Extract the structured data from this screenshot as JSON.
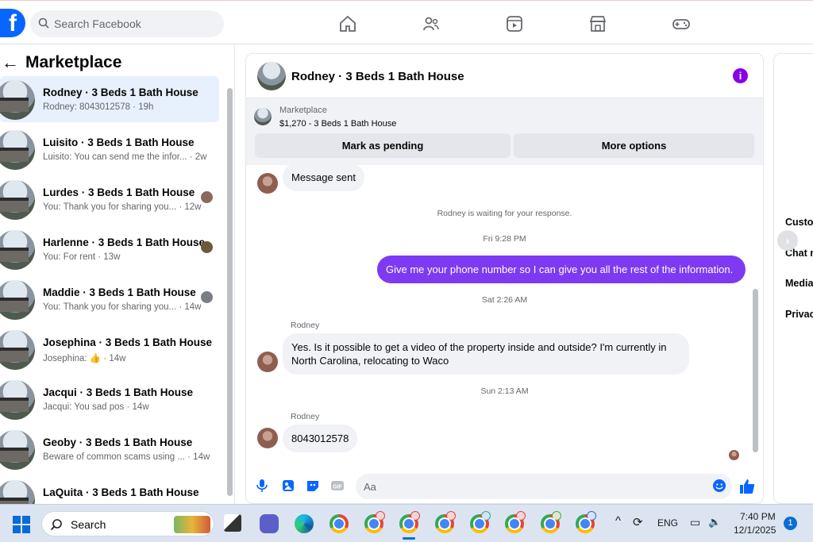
{
  "topbar": {
    "logo": "f",
    "search_placeholder": "Search Facebook",
    "nav_icons": [
      "home-icon",
      "friends-icon",
      "watch-icon",
      "marketplace-icon",
      "gaming-icon"
    ]
  },
  "sidebar": {
    "title": "Marketplace",
    "conversations": [
      {
        "name": "Rodney · 3 Beds 1 Bath House",
        "preview": "Rodney: 8043012578 · 19h",
        "selected": true
      },
      {
        "name": "Luisito · 3 Beds 1 Bath House",
        "preview": "Luisito: You can send me the infor... · 2w"
      },
      {
        "name": "Lurdes · 3 Beds 1 Bath House",
        "preview": "You: Thank you for sharing you... · 12w"
      },
      {
        "name": "Harlenne · 3 Beds 1 Bath House",
        "preview": "You: For rent · 13w"
      },
      {
        "name": "Maddie · 3 Beds 1 Bath House",
        "preview": "You: Thank you for sharing you... · 14w"
      },
      {
        "name": "Josephina · 3 Beds 1 Bath House",
        "preview": "Josephina: 👍 · 14w"
      },
      {
        "name": "Jacqui · 3 Beds 1 Bath House",
        "preview": "Jacqui: You sad pos · 14w"
      },
      {
        "name": "Geoby · 3 Beds 1 Bath House",
        "preview": "Beware of common scams using ... · 14w"
      },
      {
        "name": "LaQuita · 3 Beds 1 Bath House",
        "preview": ""
      }
    ]
  },
  "chat": {
    "header_name": "Rodney · 3 Beds 1 Bath House",
    "info_icon": "i",
    "listing": {
      "source": "Marketplace",
      "price_title": "$1,270 - 3 Beds 1 Bath House",
      "mark_pending_label": "Mark as pending",
      "more_options_label": "More options"
    },
    "messages": {
      "sent_notice": "Message sent",
      "waiting": "Rodney is waiting for your response.",
      "time1": "Fri 9:28 PM",
      "outgoing": "Give me your phone number so I can give you all the rest of the information.",
      "time2": "Sat 2:26 AM",
      "sender1": "Rodney",
      "incoming1": "Yes. Is it possible to get a video of the property inside and outside? I'm currently in North Carolina, relocating to Waco",
      "time3": "Sun 2:13 AM",
      "sender2": "Rodney",
      "incoming2": "8043012578"
    },
    "composer_placeholder": "Aa"
  },
  "right_panel": {
    "items": [
      "Custo",
      "Chat n",
      "Media",
      "Privac"
    ]
  },
  "taskbar": {
    "search_label": "Search",
    "tray_lang": "ENG",
    "time": "7:40 PM",
    "date": "12/1/2025",
    "notification_count": "1"
  }
}
